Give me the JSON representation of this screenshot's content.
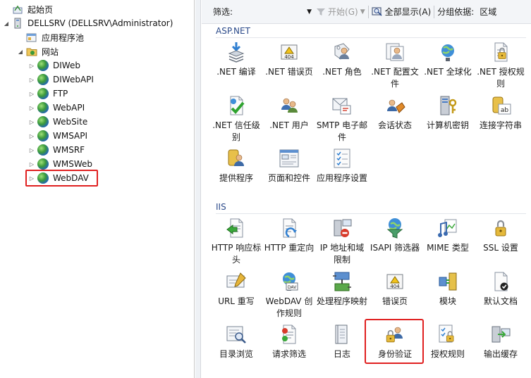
{
  "tree": {
    "items": [
      {
        "label": "起始页",
        "indent": 0,
        "expander": "",
        "icon": "start-page-icon"
      },
      {
        "label": "DELLSRV (DELLSRV\\Administrator)",
        "indent": 0,
        "expander": "◢",
        "icon": "server-icon"
      },
      {
        "label": "应用程序池",
        "indent": 1,
        "expander": "",
        "icon": "app-pool-icon"
      },
      {
        "label": "网站",
        "indent": 1,
        "expander": "◢",
        "icon": "sites-folder-icon"
      },
      {
        "label": "DIWeb",
        "indent": 2,
        "expander": "▷",
        "icon": "globe-icon"
      },
      {
        "label": "DIWebAPI",
        "indent": 2,
        "expander": "▷",
        "icon": "globe-icon"
      },
      {
        "label": "FTP",
        "indent": 2,
        "expander": "▷",
        "icon": "globe-icon"
      },
      {
        "label": "WebAPI",
        "indent": 2,
        "expander": "▷",
        "icon": "globe-icon"
      },
      {
        "label": "WebSite",
        "indent": 2,
        "expander": "▷",
        "icon": "globe-icon"
      },
      {
        "label": "WMSAPI",
        "indent": 2,
        "expander": "▷",
        "icon": "globe-icon"
      },
      {
        "label": "WMSRF",
        "indent": 2,
        "expander": "▷",
        "icon": "globe-icon"
      },
      {
        "label": "WMSWeb",
        "indent": 2,
        "expander": "▷",
        "icon": "globe-icon"
      },
      {
        "label": "WebDAV",
        "indent": 2,
        "expander": "▷",
        "icon": "globe-icon"
      }
    ],
    "selected": "WebDAV"
  },
  "toolbar": {
    "filter_label": "筛选:",
    "filter_value": "",
    "go_label": "开始(G)",
    "show_all_label": "全部显示(A)",
    "group_label": "分组依据:",
    "group_value": "区域"
  },
  "sections": [
    {
      "title": "ASP.NET",
      "tiles": [
        {
          "label": ".NET 编译",
          "icon": "compile-icon"
        },
        {
          "label": ".NET 错误页",
          "icon": "error-page-404-icon"
        },
        {
          "label": ".NET 角色",
          "icon": "roles-icon"
        },
        {
          "label": ".NET 配置文件",
          "icon": "profile-icon"
        },
        {
          "label": ".NET 全球化",
          "icon": "globalization-icon"
        },
        {
          "label": ".NET 授权规则",
          "icon": "authorization-lock-icon"
        },
        {
          "label": ".NET 信任级别",
          "icon": "trust-level-icon"
        },
        {
          "label": ".NET 用户",
          "icon": "users-icon"
        },
        {
          "label": "SMTP 电子邮件",
          "icon": "smtp-mail-icon"
        },
        {
          "label": "会话状态",
          "icon": "session-state-icon"
        },
        {
          "label": "计算机密钥",
          "icon": "machine-key-icon"
        },
        {
          "label": "连接字符串",
          "icon": "connection-string-icon"
        },
        {
          "label": "提供程序",
          "icon": "providers-icon"
        },
        {
          "label": "页面和控件",
          "icon": "pages-controls-icon"
        },
        {
          "label": "应用程序设置",
          "icon": "app-settings-icon"
        }
      ]
    },
    {
      "title": "IIS",
      "tiles": [
        {
          "label": "HTTP 响应标头",
          "icon": "http-headers-icon"
        },
        {
          "label": "HTTP 重定向",
          "icon": "http-redirect-icon"
        },
        {
          "label": "IP 地址和域限制",
          "icon": "ip-restrictions-icon"
        },
        {
          "label": "ISAPI 筛选器",
          "icon": "isapi-filter-icon"
        },
        {
          "label": "MIME 类型",
          "icon": "mime-types-icon"
        },
        {
          "label": "SSL 设置",
          "icon": "ssl-lock-icon"
        },
        {
          "label": "URL 重写",
          "icon": "url-rewrite-icon"
        },
        {
          "label": "WebDAV 创作规则",
          "icon": "webdav-icon"
        },
        {
          "label": "处理程序映射",
          "icon": "handler-mappings-icon"
        },
        {
          "label": "错误页",
          "icon": "error-pages-404-icon"
        },
        {
          "label": "模块",
          "icon": "modules-icon"
        },
        {
          "label": "默认文档",
          "icon": "default-document-icon"
        },
        {
          "label": "目录浏览",
          "icon": "directory-browsing-icon"
        },
        {
          "label": "请求筛选",
          "icon": "request-filtering-icon"
        },
        {
          "label": "日志",
          "icon": "logging-icon"
        },
        {
          "label": "身份验证",
          "icon": "authentication-icon"
        },
        {
          "label": "授权规则",
          "icon": "authorization-rules-icon"
        },
        {
          "label": "输出缓存",
          "icon": "output-cache-icon"
        }
      ]
    }
  ],
  "selected_tile": "身份验证",
  "colors": {
    "highlight": "#e02020",
    "section_title": "#2b4a8a"
  }
}
